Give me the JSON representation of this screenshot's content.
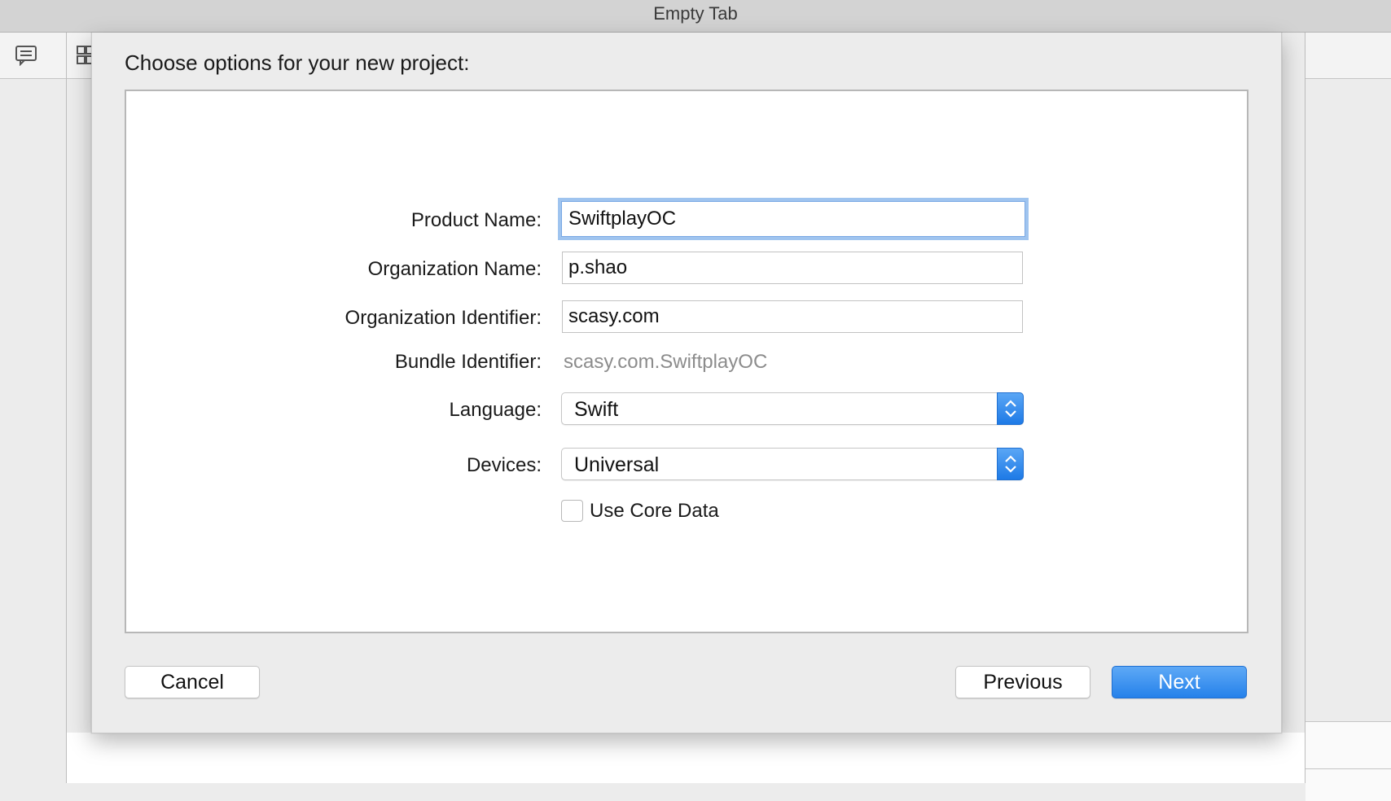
{
  "window": {
    "title": "Empty Tab"
  },
  "sidebar": {
    "icons": [
      "comment-icon",
      "grid-icon"
    ]
  },
  "dialog": {
    "title": "Choose options for your new project:",
    "fields": {
      "product_name": {
        "label": "Product Name:",
        "value": "SwiftplayOC"
      },
      "organization_name": {
        "label": "Organization Name:",
        "value": "p.shao"
      },
      "organization_identifier": {
        "label": "Organization Identifier:",
        "value": "scasy.com"
      },
      "bundle_identifier": {
        "label": "Bundle Identifier:",
        "value": "scasy.com.SwiftplayOC"
      },
      "language": {
        "label": "Language:",
        "value": "Swift"
      },
      "devices": {
        "label": "Devices:",
        "value": "Universal"
      },
      "use_core_data": {
        "label": "Use Core Data",
        "checked": false
      }
    },
    "buttons": {
      "cancel": "Cancel",
      "previous": "Previous",
      "next": "Next"
    },
    "colors": {
      "accent": "#2581ea",
      "focus_ring": "#9fc4ef"
    }
  }
}
